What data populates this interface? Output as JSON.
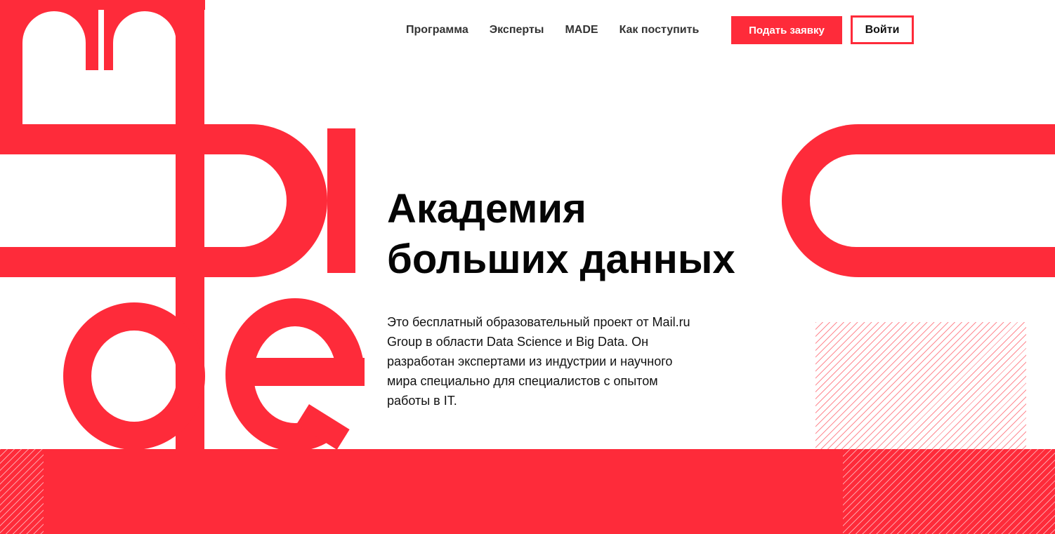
{
  "brand": {
    "accent_color": "#fe2b3a",
    "logo_letters": "made"
  },
  "nav": {
    "items": [
      {
        "label": "Программа"
      },
      {
        "label": "Эксперты"
      },
      {
        "label": "MADE"
      },
      {
        "label": "Как поступить"
      }
    ]
  },
  "header": {
    "apply_label": "Подать заявку",
    "login_label": "Войти"
  },
  "hero": {
    "title_line1": "Академия",
    "title_line2": "больших данных",
    "description": "Это бесплатный образовательный проект от Mail.ru Group в области Data Science и Big Data. Он разработан экспертами из индустрии и научного мира специально для специалистов с опытом работы в IT."
  }
}
